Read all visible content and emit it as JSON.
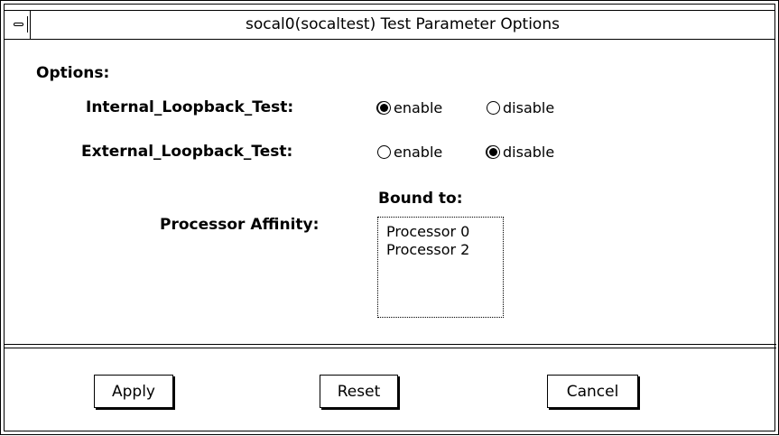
{
  "window": {
    "title": "socal0(socaltest) Test Parameter Options"
  },
  "options_label": "Options:",
  "internal_loopback": {
    "label": "Internal_Loopback_Test:",
    "enable_label": "enable",
    "disable_label": "disable",
    "selected": "enable"
  },
  "external_loopback": {
    "label": "External_Loopback_Test:",
    "enable_label": "enable",
    "disable_label": "disable",
    "selected": "disable"
  },
  "processor_affinity": {
    "label": "Processor Affinity:",
    "bound_to_label": "Bound to:",
    "items": [
      "Processor 0",
      "Processor 2"
    ]
  },
  "buttons": {
    "apply": "Apply",
    "reset": "Reset",
    "cancel": "Cancel"
  },
  "icons": {
    "window_menu": "window-menu-icon"
  }
}
